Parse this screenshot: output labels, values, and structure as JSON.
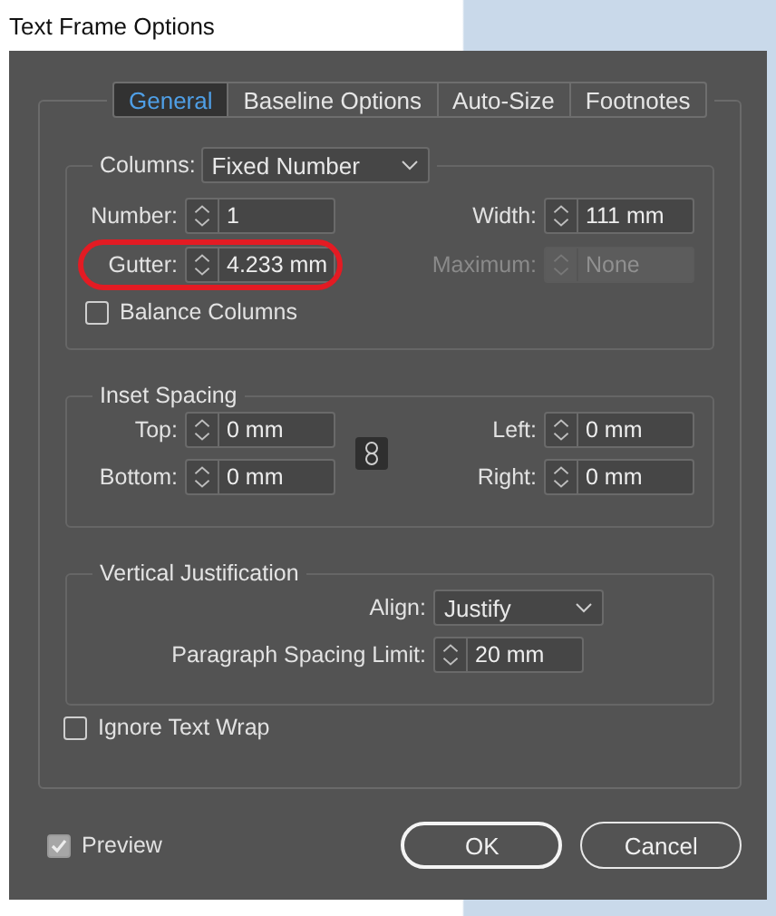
{
  "window": {
    "title": "Text Frame Options"
  },
  "tabs": [
    {
      "label": "General",
      "selected": true
    },
    {
      "label": "Baseline Options",
      "selected": false
    },
    {
      "label": "Auto-Size",
      "selected": false
    },
    {
      "label": "Footnotes",
      "selected": false
    }
  ],
  "columns": {
    "label": "Columns:",
    "value": "Fixed Number",
    "rows": [
      {
        "left": {
          "label": "Number:",
          "value": "1",
          "disabled": false,
          "highlighted": false
        },
        "right": {
          "label": "Width:",
          "value": "111 mm",
          "disabled": false,
          "highlighted": false
        }
      },
      {
        "left": {
          "label": "Gutter:",
          "value": "4.233 mm",
          "disabled": false,
          "highlighted": true
        },
        "right": {
          "label": "Maximum:",
          "value": "None",
          "disabled": true,
          "highlighted": false
        }
      }
    ],
    "balance": {
      "label": "Balance Columns",
      "checked": false
    }
  },
  "inset_spacing": {
    "title": "Inset Spacing",
    "left": [
      {
        "label": "Top:",
        "value": "0 mm"
      },
      {
        "label": "Bottom:",
        "value": "0 mm"
      }
    ],
    "right": [
      {
        "label": "Left:",
        "value": "0 mm"
      },
      {
        "label": "Right:",
        "value": "0 mm"
      }
    ]
  },
  "vertical_justification": {
    "title": "Vertical Justification",
    "align": {
      "label": "Align:",
      "value": "Justify"
    },
    "spacing_limit": {
      "label": "Paragraph Spacing Limit:",
      "value": "20 mm"
    }
  },
  "ignore_text_wrap": {
    "label": "Ignore Text Wrap",
    "checked": false
  },
  "preview": {
    "label": "Preview",
    "checked": true
  },
  "buttons": [
    "OK",
    "Cancel"
  ]
}
